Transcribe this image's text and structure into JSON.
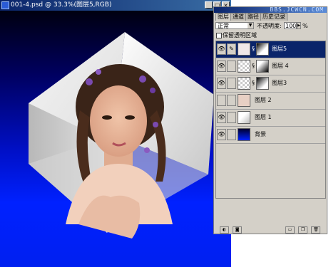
{
  "document": {
    "title": "001-4.psd @ 33.3%(图层5,RGB)",
    "controls": {
      "minimize": "_",
      "maximize": "□",
      "close": "×"
    }
  },
  "colors": {
    "titlebar": "#0a246a",
    "canvas_bottom": "#0021ff",
    "canvas_top": "#000010",
    "selected_layer": "#0a246a"
  },
  "palette": {
    "watermark": "BBS.JCWCN.COM",
    "tabs": [
      {
        "label": "图层",
        "active": true
      },
      {
        "label": "通道",
        "active": false
      },
      {
        "label": "路径",
        "active": false
      },
      {
        "label": "历史记录",
        "active": false
      }
    ],
    "blend_mode": "正常",
    "opacity_label": "不透明度:",
    "opacity_value": "100",
    "opacity_unit": "%",
    "preserve_transparency": "保留透明区域",
    "layers": [
      {
        "name": "图层5",
        "selected": true,
        "visible": true,
        "has_mask": true,
        "brush": true
      },
      {
        "name": "图层 4",
        "selected": false,
        "visible": true,
        "has_mask": true,
        "brush": false
      },
      {
        "name": "图层3",
        "selected": false,
        "visible": true,
        "has_mask": true,
        "brush": false
      },
      {
        "name": "图层 2",
        "selected": false,
        "visible": false,
        "has_mask": false,
        "brush": false
      },
      {
        "name": "图层 1",
        "selected": false,
        "visible": true,
        "has_mask": false,
        "brush": false
      },
      {
        "name": "背景",
        "selected": false,
        "visible": true,
        "has_mask": false,
        "brush": false
      }
    ]
  }
}
